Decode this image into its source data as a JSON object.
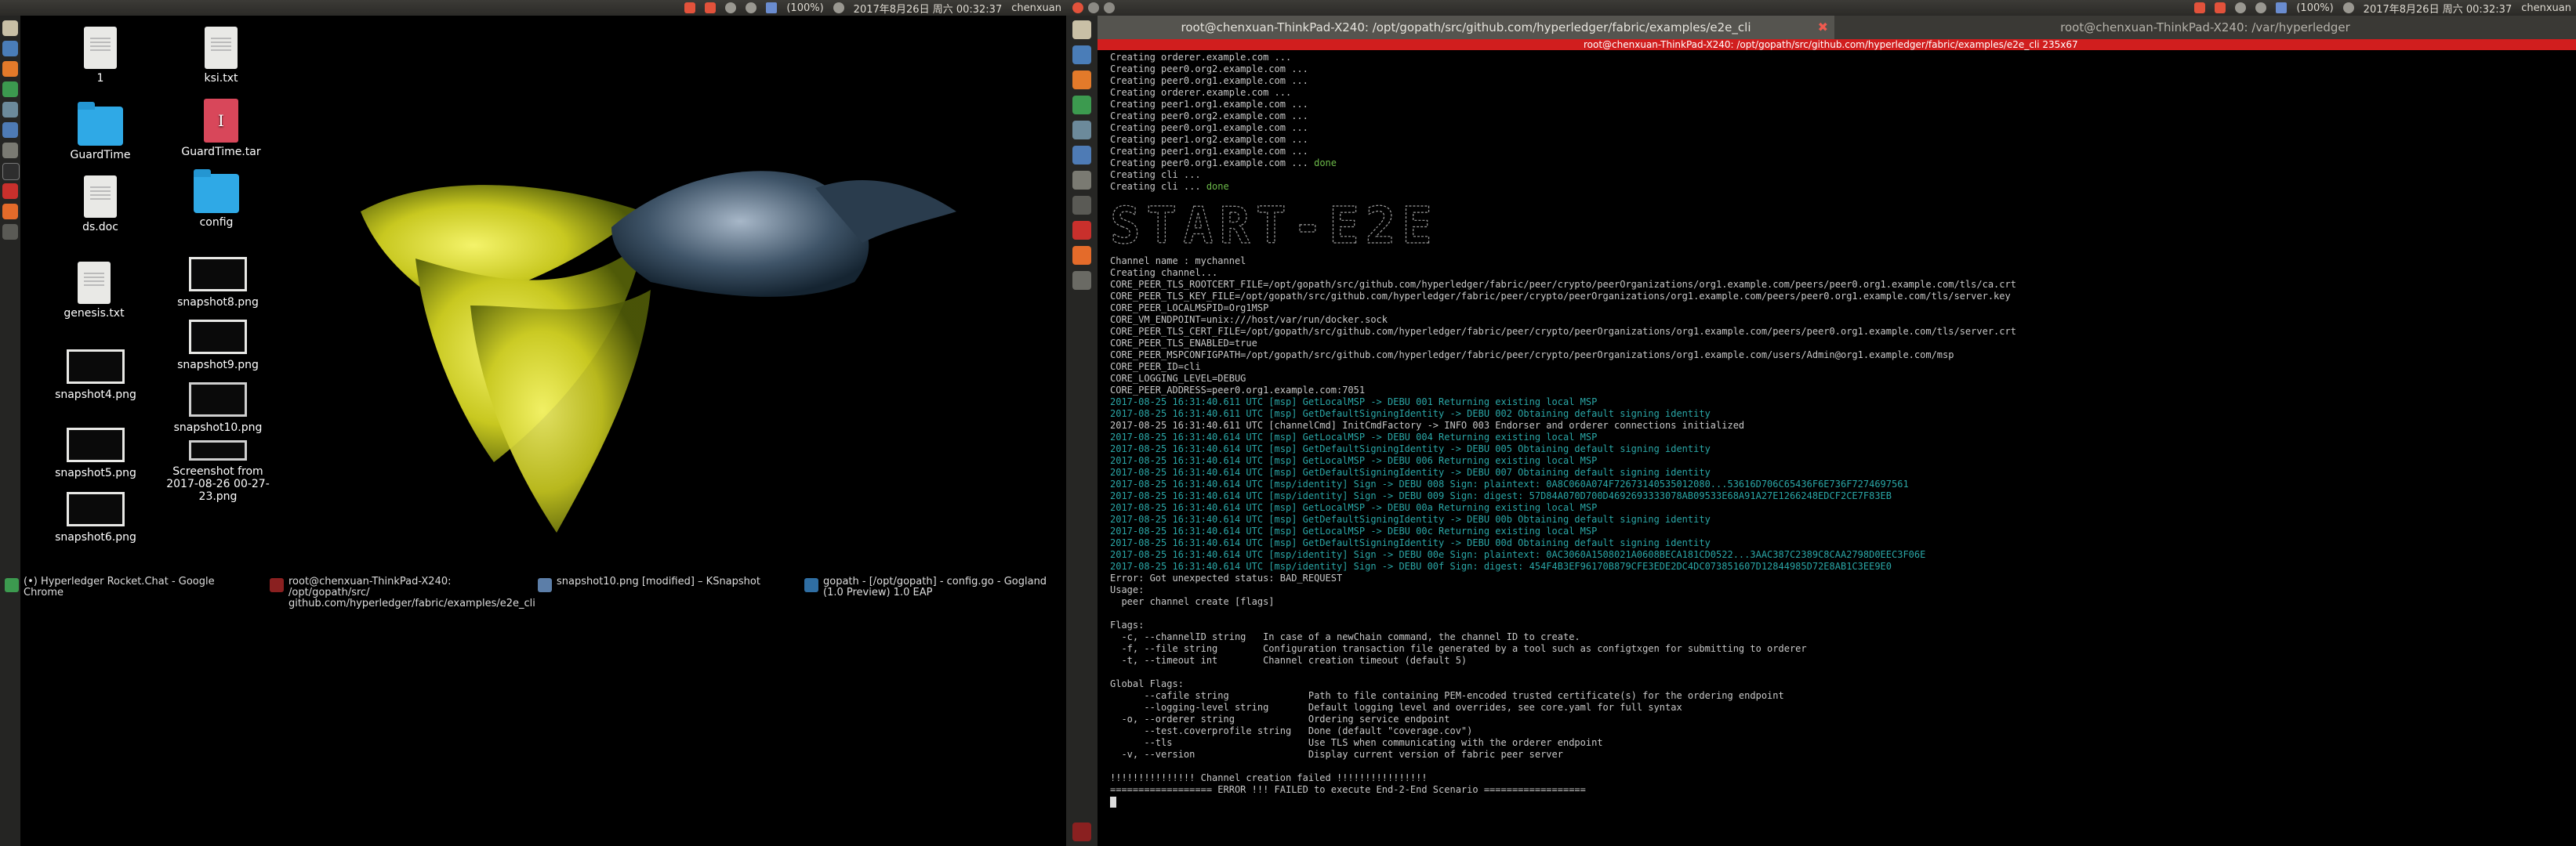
{
  "left_screen": {
    "panel": {
      "battery": "(100%)",
      "datetime": "2017年8月26日 周六 00:32:37",
      "user": "chenxuan"
    },
    "desktop_icons": [
      {
        "label": "1",
        "kind": "document"
      },
      {
        "label": "ksi.txt",
        "kind": "document"
      },
      {
        "label": "GuardTime",
        "kind": "folder"
      },
      {
        "label": "GuardTime.tar",
        "kind": "archive"
      },
      {
        "label": "ds.doc",
        "kind": "document"
      },
      {
        "label": "config",
        "kind": "folder"
      },
      {
        "label": "genesis.txt",
        "kind": "document"
      },
      {
        "label": "snapshot8.png",
        "kind": "image"
      },
      {
        "label": "snapshot4.png",
        "kind": "image"
      },
      {
        "label": "snapshot9.png",
        "kind": "image"
      },
      {
        "label": "snapshot5.png",
        "kind": "image"
      },
      {
        "label": "snapshot10.png",
        "kind": "image"
      },
      {
        "label": "snapshot6.png",
        "kind": "image"
      },
      {
        "label": "Screenshot from 2017-08-26 00-27-23.png",
        "kind": "image"
      }
    ],
    "taskbar": [
      {
        "label": "(•) Hyperledger Rocket.Chat - Google Chrome",
        "icon": "chrome-icon"
      },
      {
        "label": "root@chenxuan-ThinkPad-X240: /opt/gopath/src/ github.com/hyperledger/fabric/examples/e2e_cli",
        "icon": "terminal-icon"
      },
      {
        "label": "snapshot10.png [modified] – KSnapshot",
        "icon": "ksnapshot-icon"
      },
      {
        "label": "gopath - [/opt/gopath] - config.go - Gogland (1.0 Preview) 1.0 EAP",
        "icon": "gogland-icon"
      }
    ]
  },
  "right_screen": {
    "panel": {
      "battery": "(100%)",
      "datetime": "2017年8月26日 周六 00:32:37",
      "user": "chenxuan"
    },
    "tabs": [
      {
        "label": "root@chenxuan-ThinkPad-X240: /opt/gopath/src/github.com/hyperledger/fabric/examples/e2e_cli",
        "active": true
      },
      {
        "label": "root@chenxuan-ThinkPad-X240: /var/hyperledger",
        "active": false
      }
    ],
    "title_bar": "root@chenxuan-ThinkPad-X240: /opt/gopath/src/github.com/hyperledger/fabric/examples/e2e_cli 235x67",
    "banner_text": "START-E2E",
    "terminal_lines": [
      {
        "text": "Creating orderer.example.com ...",
        "style": "plain"
      },
      {
        "text": "Creating peer0.org2.example.com ...",
        "style": "plain"
      },
      {
        "text": "Creating peer0.org1.example.com ...",
        "style": "plain"
      },
      {
        "text": "Creating orderer.example.com ...",
        "style": "plain"
      },
      {
        "text": "Creating peer1.org1.example.com ...",
        "style": "plain"
      },
      {
        "text": "Creating peer0.org2.example.com ...",
        "style": "plain"
      },
      {
        "text": "Creating peer0.org1.example.com ...",
        "style": "plain"
      },
      {
        "text": "Creating peer1.org2.example.com ...",
        "style": "plain"
      },
      {
        "text": "Creating peer1.org1.example.com ...",
        "style": "plain"
      },
      {
        "text": "Creating peer0.org1.example.com ... ",
        "done": "done",
        "style": "plain"
      },
      {
        "text": "Creating cli ...",
        "style": "plain"
      },
      {
        "text": "Creating cli ... ",
        "done": "done",
        "style": "plain"
      },
      {
        "text": "",
        "style": "banner"
      },
      {
        "text": "Channel name : mychannel",
        "style": "plain"
      },
      {
        "text": "Creating channel...",
        "style": "plain"
      },
      {
        "text": "CORE_PEER_TLS_ROOTCERT_FILE=/opt/gopath/src/github.com/hyperledger/fabric/peer/crypto/peerOrganizations/org1.example.com/peers/peer0.org1.example.com/tls/ca.crt",
        "style": "plain"
      },
      {
        "text": "CORE_PEER_TLS_KEY_FILE=/opt/gopath/src/github.com/hyperledger/fabric/peer/crypto/peerOrganizations/org1.example.com/peers/peer0.org1.example.com/tls/server.key",
        "style": "plain"
      },
      {
        "text": "CORE_PEER_LOCALMSPID=Org1MSP",
        "style": "plain"
      },
      {
        "text": "CORE_VM_ENDPOINT=unix:///host/var/run/docker.sock",
        "style": "plain"
      },
      {
        "text": "CORE_PEER_TLS_CERT_FILE=/opt/gopath/src/github.com/hyperledger/fabric/peer/crypto/peerOrganizations/org1.example.com/peers/peer0.org1.example.com/tls/server.crt",
        "style": "plain"
      },
      {
        "text": "CORE_PEER_TLS_ENABLED=true",
        "style": "plain"
      },
      {
        "text": "CORE_PEER_MSPCONFIGPATH=/opt/gopath/src/github.com/hyperledger/fabric/peer/crypto/peerOrganizations/org1.example.com/users/Admin@org1.example.com/msp",
        "style": "plain"
      },
      {
        "text": "CORE_PEER_ID=cli",
        "style": "plain"
      },
      {
        "text": "CORE_LOGGING_LEVEL=DEBUG",
        "style": "plain"
      },
      {
        "text": "CORE_PEER_ADDRESS=peer0.org1.example.com:7051",
        "style": "plain"
      },
      {
        "text": "2017-08-25 16:31:40.611 UTC [msp] GetLocalMSP -> DEBU 001 Returning existing local MSP",
        "style": "teal"
      },
      {
        "text": "2017-08-25 16:31:40.611 UTC [msp] GetDefaultSigningIdentity -> DEBU 002 Obtaining default signing identity",
        "style": "teal"
      },
      {
        "text": "2017-08-25 16:31:40.611 UTC [channelCmd] InitCmdFactory -> INFO 003 Endorser and orderer connections initialized",
        "style": "plain"
      },
      {
        "text": "2017-08-25 16:31:40.614 UTC [msp] GetLocalMSP -> DEBU 004 Returning existing local MSP",
        "style": "teal"
      },
      {
        "text": "2017-08-25 16:31:40.614 UTC [msp] GetDefaultSigningIdentity -> DEBU 005 Obtaining default signing identity",
        "style": "teal"
      },
      {
        "text": "2017-08-25 16:31:40.614 UTC [msp] GetLocalMSP -> DEBU 006 Returning existing local MSP",
        "style": "teal"
      },
      {
        "text": "2017-08-25 16:31:40.614 UTC [msp] GetDefaultSigningIdentity -> DEBU 007 Obtaining default signing identity",
        "style": "teal"
      },
      {
        "text": "2017-08-25 16:31:40.614 UTC [msp/identity] Sign -> DEBU 008 Sign: plaintext: 0A8C060A074F72673140535012080...53616D706C65436F6E736F7274697561",
        "style": "teal"
      },
      {
        "text": "2017-08-25 16:31:40.614 UTC [msp/identity] Sign -> DEBU 009 Sign: digest: 57D84A070D700D4692693333078AB09533E68A91A27E1266248EDCF2CE7F83EB",
        "style": "teal"
      },
      {
        "text": "2017-08-25 16:31:40.614 UTC [msp] GetLocalMSP -> DEBU 00a Returning existing local MSP",
        "style": "teal"
      },
      {
        "text": "2017-08-25 16:31:40.614 UTC [msp] GetDefaultSigningIdentity -> DEBU 00b Obtaining default signing identity",
        "style": "teal"
      },
      {
        "text": "2017-08-25 16:31:40.614 UTC [msp] GetLocalMSP -> DEBU 00c Returning existing local MSP",
        "style": "teal"
      },
      {
        "text": "2017-08-25 16:31:40.614 UTC [msp] GetDefaultSigningIdentity -> DEBU 00d Obtaining default signing identity",
        "style": "teal"
      },
      {
        "text": "2017-08-25 16:31:40.614 UTC [msp/identity] Sign -> DEBU 00e Sign: plaintext: 0AC3060A1508021A0608BECA181CD0522...3AAC387C2389C8CAA2798D0EEC3F06E",
        "style": "teal"
      },
      {
        "text": "2017-08-25 16:31:40.614 UTC [msp/identity] Sign -> DEBU 00f Sign: digest: 454F4B3EF96170B879CFE3EDE2DC4DC073851607D12844985D72E8AB1C3EE9E0",
        "style": "teal"
      },
      {
        "text": "Error: Got unexpected status: BAD_REQUEST",
        "style": "plain"
      },
      {
        "text": "Usage:",
        "style": "plain"
      },
      {
        "text": "  peer channel create [flags]",
        "style": "plain"
      },
      {
        "text": "",
        "style": "plain"
      },
      {
        "text": "Flags:",
        "style": "plain"
      },
      {
        "text": "  -c, --channelID string   In case of a newChain command, the channel ID to create.",
        "style": "plain"
      },
      {
        "text": "  -f, --file string        Configuration transaction file generated by a tool such as configtxgen for submitting to orderer",
        "style": "plain"
      },
      {
        "text": "  -t, --timeout int        Channel creation timeout (default 5)",
        "style": "plain"
      },
      {
        "text": "",
        "style": "plain"
      },
      {
        "text": "Global Flags:",
        "style": "plain"
      },
      {
        "text": "      --cafile string              Path to file containing PEM-encoded trusted certificate(s) for the ordering endpoint",
        "style": "plain"
      },
      {
        "text": "      --logging-level string       Default logging level and overrides, see core.yaml for full syntax",
        "style": "plain"
      },
      {
        "text": "  -o, --orderer string             Ordering service endpoint",
        "style": "plain"
      },
      {
        "text": "      --test.coverprofile string   Done (default \"coverage.cov\")",
        "style": "plain"
      },
      {
        "text": "      --tls                        Use TLS when communicating with the orderer endpoint",
        "style": "plain"
      },
      {
        "text": "  -v, --version                    Display current version of fabric peer server",
        "style": "plain"
      },
      {
        "text": "",
        "style": "plain"
      },
      {
        "text": "!!!!!!!!!!!!!!! Channel creation failed !!!!!!!!!!!!!!!!",
        "style": "plain"
      },
      {
        "text": "================== ERROR !!! FAILED to execute End-2-End Scenario ==================",
        "style": "plain"
      }
    ]
  }
}
